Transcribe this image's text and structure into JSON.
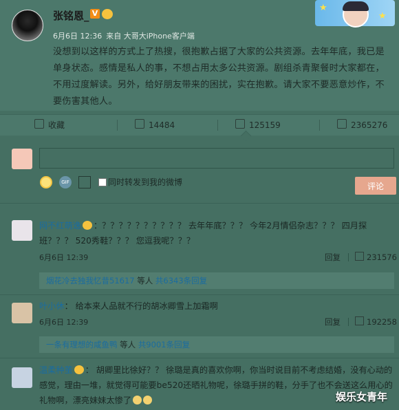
{
  "post": {
    "author": "张铭恩_",
    "verified_badge": "V",
    "date": "6月6日 12:36",
    "source": "来自 大哥大iPhone客户端",
    "body": "没想到以这样的方式上了热搜，很抱歉占据了大家的公共资源。去年年底，我已是单身状态。感情是私人的事，不想占用太多公共资源。剧组杀青聚餐时大家都在，不用过度解读。另外，给好朋友带来的困扰，实在抱歉。请大家不要恶意炒作，不要伤害其他人。"
  },
  "actions": {
    "favorite": "收藏",
    "repost": "14484",
    "comment": "125159",
    "like": "2365276"
  },
  "composer": {
    "forward_label": "同时转发到我的微博",
    "submit": "评论",
    "gif_label": "GIF"
  },
  "comments": [
    {
      "name": "网不红萌逸",
      "text": "：？？？？？？？？？？ 去年年底？？？ 今年2月情侣杂志？？？ 四月探班？？？ 520秀鞋？？？ 您逗我呢？？？",
      "time": "6月6日 12:39",
      "reply": "回复",
      "likes": "231576",
      "sub_user": "烟花冷去独我忆昔51617",
      "sub_mid": " 等人 ",
      "sub_count": "共6343条回复"
    },
    {
      "name": "叶小休",
      "text": "： 给本来人品就不行的胡冰卿雪上加霜啊",
      "time": "6月6日 12:39",
      "reply": "回复",
      "likes": "192258",
      "sub_user": "一条有理想的咸鱼鸭",
      "sub_mid": " 等人 ",
      "sub_count": "共9001条回复"
    },
    {
      "name": "温柔种茧",
      "text": "： 胡卿里比徐好？？ 徐璐是真的喜欢你啊，你当时说目前不考虑结婚，没有心动的感觉，理由一堆，就觉得可能要be520还晒礼物呢，徐璐手拼的鞋，分手了也不会送这么用心的礼物啊，漂亮妹妹太惨了"
    }
  ],
  "watermark": "娱乐女青年"
}
